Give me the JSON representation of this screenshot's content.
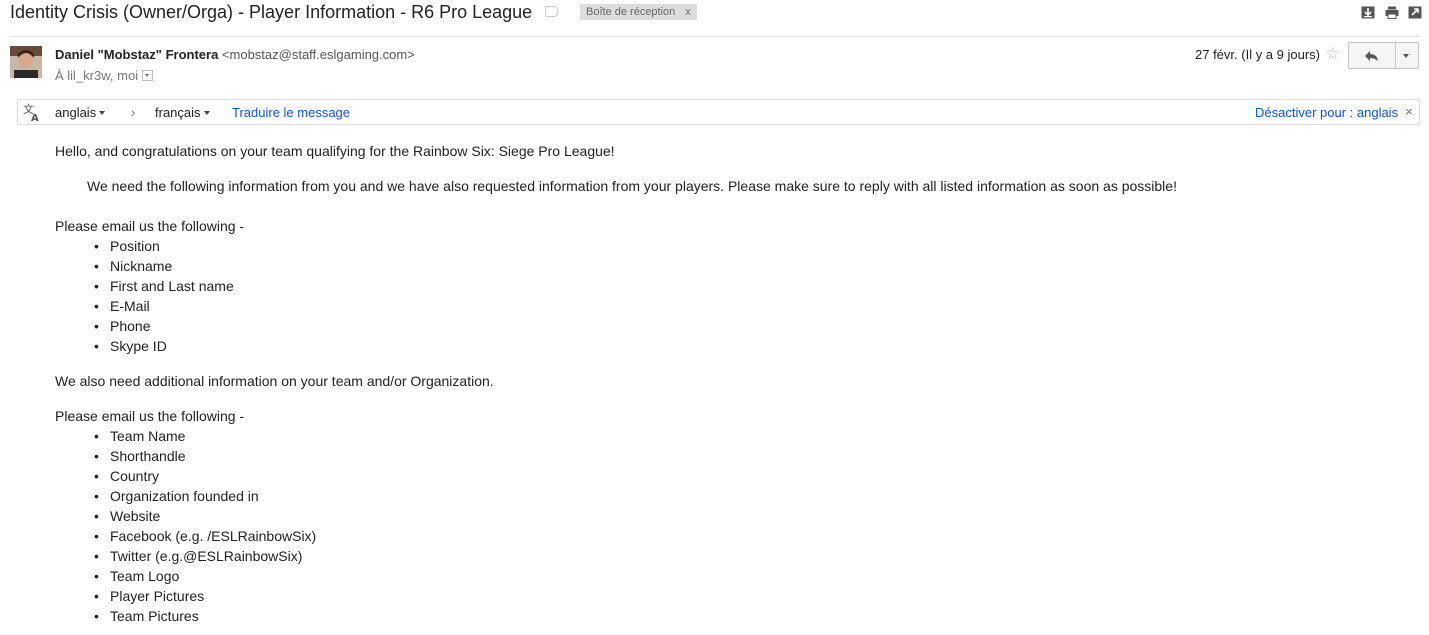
{
  "subject": "Identity Crisis (Owner/Orga) - Player Information - R6 Pro League",
  "label": {
    "name": "Boîte de réception",
    "remove": "x"
  },
  "top_icons": [
    "download-icon",
    "print-icon",
    "new-window-icon"
  ],
  "sender": {
    "name": "Daniel \"Mobstaz\" Frontera",
    "email": "<mobstaz@staff.eslgaming.com>",
    "recipients": "À lil_kr3w, moi",
    "date": "27 févr. (Il y a 9 jours)"
  },
  "translate_bar": {
    "source_lang": "anglais",
    "arrow": "›",
    "target_lang": "français",
    "translate_link": "Traduire le message",
    "disable_link": "Désactiver pour : anglais",
    "close": "×"
  },
  "body": {
    "greeting": "Hello, and congratulations on your team qualifying for the Rainbow Six: Siege Pro League!",
    "need": "We need the following information from you and we have also requested information from your players. Please make sure to reply with all listed information as soon as possible!",
    "email_intro_1": "Please email us the following -",
    "list_1": [
      "Position",
      "Nickname",
      "First and Last name",
      "E-Mail",
      "Phone",
      "Skype ID"
    ],
    "also": "We also need additional information on your team and/or Organization.",
    "email_intro_2": "Please email us the following -",
    "list_2": [
      "Team Name",
      "Shorthandle",
      "Country",
      "Organization founded in",
      "Website",
      "Facebook (e.g. /ESLRainbowSix)",
      "Twitter (e.g.@ESLRainbowSix)",
      "Team Logo",
      "Player Pictures",
      "Team Pictures"
    ]
  },
  "colors": {
    "link": "#1155cc",
    "label_bg": "#dddddd",
    "text": "#222222"
  }
}
